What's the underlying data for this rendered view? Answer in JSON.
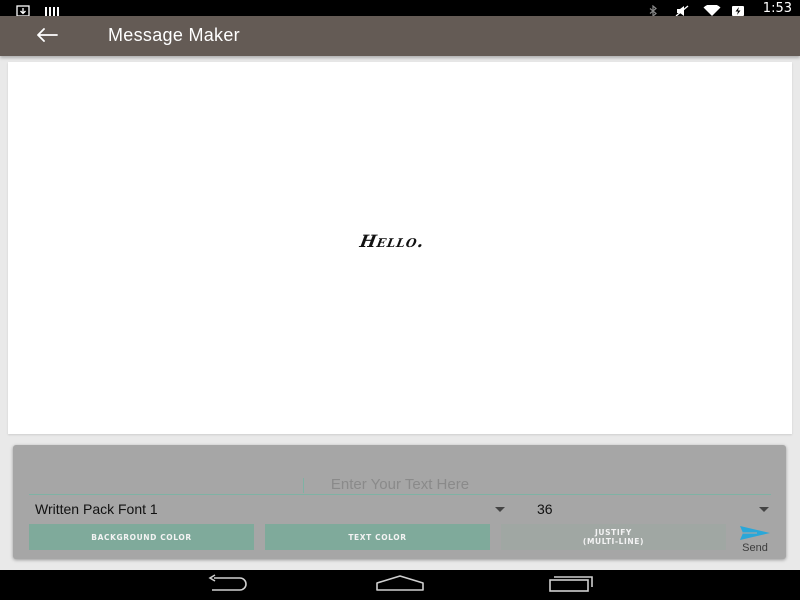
{
  "status_bar": {
    "time": "1:53",
    "icons": [
      "download-icon",
      "signal-bars-icon",
      "bluetooth-icon",
      "mute-icon",
      "wifi-icon",
      "battery-charging-icon"
    ]
  },
  "app_bar": {
    "title": "Message Maker",
    "back_icon": "arrow-back-icon"
  },
  "preview": {
    "text": "Hello."
  },
  "editor": {
    "input_placeholder": "Enter Your Text Here",
    "input_value": "",
    "font_select_value": "Written Pack Font 1",
    "size_select_value": "36",
    "buttons": {
      "background_color": "BACKGROUND COLOR",
      "text_color": "TEXT COLOR",
      "justify": "JUSTIFY\n(MULTI-LINE)"
    },
    "send_label": "Send",
    "send_icon": "send-icon"
  },
  "colors": {
    "app_bar": "#645b55",
    "accent": "#7faa9b",
    "send": "#2aa7d8",
    "panel": "#a6a6a6"
  },
  "nav_bar": {
    "icons": [
      "nav-back-icon",
      "nav-home-icon",
      "nav-recent-icon"
    ]
  }
}
